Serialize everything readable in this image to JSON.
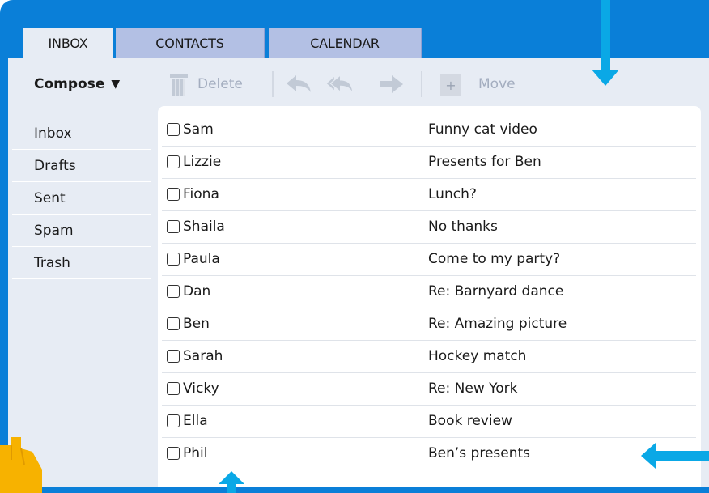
{
  "tabs": [
    {
      "label": "INBOX",
      "active": true
    },
    {
      "label": "CONTACTS",
      "active": false
    },
    {
      "label": "CALENDAR",
      "active": false
    }
  ],
  "toolbar": {
    "compose_label": "Compose",
    "compose_caret": "▼",
    "delete_label": "Delete",
    "move_label": "Move",
    "move_icon": "+"
  },
  "sidebar": {
    "items": [
      {
        "label": "Inbox"
      },
      {
        "label": "Drafts"
      },
      {
        "label": "Sent"
      },
      {
        "label": "Spam"
      },
      {
        "label": "Trash"
      }
    ]
  },
  "messages": [
    {
      "sender": "Sam",
      "subject": "Funny cat video"
    },
    {
      "sender": "Lizzie",
      "subject": "Presents for Ben"
    },
    {
      "sender": "Fiona",
      "subject": "Lunch?"
    },
    {
      "sender": "Shaila",
      "subject": "No thanks"
    },
    {
      "sender": "Paula",
      "subject": "Come to my party?"
    },
    {
      "sender": "Dan",
      "subject": "Re: Barnyard dance"
    },
    {
      "sender": "Ben",
      "subject": "Re: Amazing picture"
    },
    {
      "sender": "Sarah",
      "subject": "Hockey match"
    },
    {
      "sender": "Vicky",
      "subject": "Re: New York"
    },
    {
      "sender": "Ella",
      "subject": "Book review"
    },
    {
      "sender": "Phil",
      "subject": "Ben’s presents"
    }
  ],
  "colors": {
    "frame": "#0a7fd8",
    "panel": "#e7ecf4",
    "inactive_tab": "#b3c0e4",
    "highlight_arrow": "#0aa8e6",
    "disabled_tool": "#a3adbf"
  },
  "icons": [
    "trash-icon",
    "reply-icon",
    "reply-all-icon",
    "forward-icon",
    "move-icon",
    "dropdown-caret-icon",
    "checkbox-icon"
  ]
}
